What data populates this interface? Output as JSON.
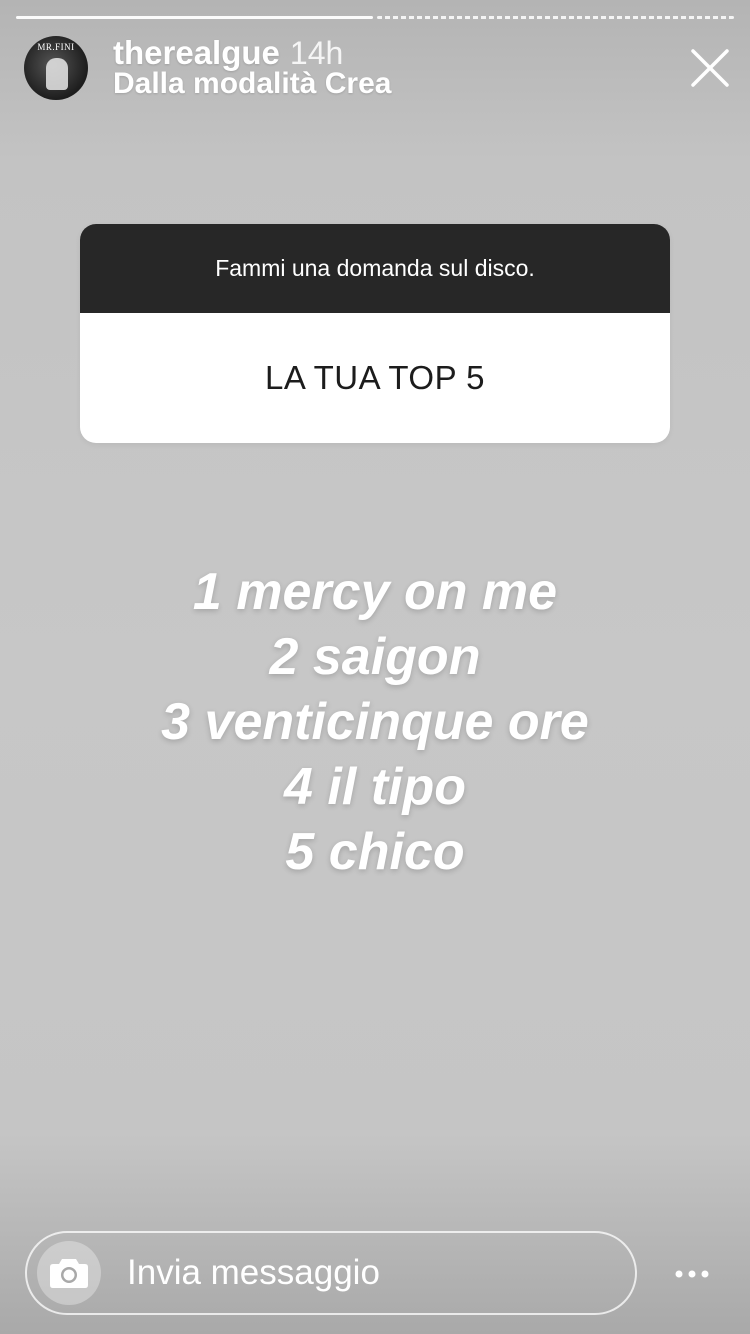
{
  "story": {
    "segments": 2,
    "active_segment": 1,
    "avatar_text": "MR.FINI",
    "username": "therealgue",
    "time_ago": "14h",
    "subtitle": "Dalla modalità Crea"
  },
  "question_sticker": {
    "prompt": "Fammi una domanda sul disco.",
    "answer": "LA TUA TOP 5"
  },
  "top_list": [
    "1 mercy on me",
    "2 saigon",
    "3 venticinque ore",
    "4 il tipo",
    "5 chico"
  ],
  "reply": {
    "placeholder": "Invia messaggio"
  },
  "icons": {
    "close": "close-icon",
    "camera": "camera-icon",
    "more": "more-icon"
  },
  "colors": {
    "sticker_header": "#272727",
    "sticker_body": "#ffffff",
    "background": "#c6c6c6"
  }
}
